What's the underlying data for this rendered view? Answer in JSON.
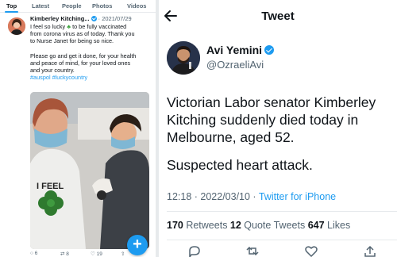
{
  "left_panel": {
    "tabs": [
      "Top",
      "Latest",
      "People",
      "Photos",
      "Videos"
    ],
    "active_tab": "Top",
    "tweet": {
      "author_name": "Kimberley Kitching...",
      "date": "· 2021/07/29",
      "line1_pre": "I feel so lucky",
      "line1_post": " to be fully vaccinated",
      "line2": "from corona virus as of today.  Thank you",
      "line3": "to Nurse Janet for being so nice.",
      "line4": "Please go and get it done, for your health",
      "line5": "and peace of mind, for your loved ones",
      "line6": "and your country.",
      "hashtags": "#auspol #luckycountry",
      "photo_shirt_text": "I FEEL",
      "reply_count": "6",
      "retweet_count": "8",
      "like_count": "19"
    },
    "compose_label": "+"
  },
  "right_panel": {
    "header_title": "Tweet",
    "author_name": "Avi Yemini",
    "author_handle": "@OzraeliAvi",
    "text": "Victorian Labor senator Kimberley Kitching suddenly died today in Melbourne, aged 52.",
    "text2": "Suspected heart attack.",
    "time": "12:18 · 2022/03/10 · ",
    "source": "Twitter for iPhone",
    "retweets_count": "170",
    "retweets_label": " Retweets  ",
    "quotes_count": "12",
    "quotes_label": " Quote Tweets  ",
    "likes_count": "647",
    "likes_label": " Likes"
  },
  "colors": {
    "accent": "#1d9bf0",
    "text": "#0f1419",
    "muted": "#536471",
    "divider": "#e7eaec"
  },
  "icons": [
    "back-arrow-icon",
    "verified-badge-icon",
    "reply-icon",
    "retweet-icon",
    "like-icon",
    "share-icon",
    "compose-icon"
  ]
}
